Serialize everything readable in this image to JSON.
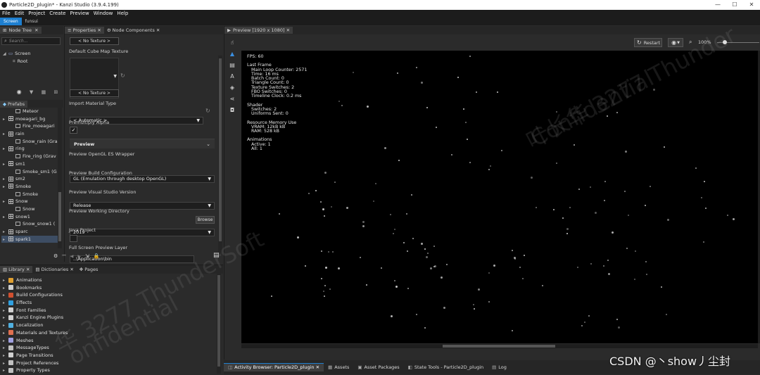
{
  "window": {
    "title": "Particle2D_plugin* - Kanzi Studio (3.9.4.199)",
    "controls": [
      "—",
      "☐",
      "✕"
    ]
  },
  "menu": [
    "File",
    "Edit",
    "Project",
    "Create",
    "Preview",
    "Window",
    "Help"
  ],
  "screen_tabs": [
    "Screen",
    "funsui"
  ],
  "node_tree": {
    "tab": "Node Tree",
    "search_placeholder": "Search...",
    "items": [
      {
        "label": "Screen",
        "icon": "monitor-icon",
        "indent": 0,
        "expanded": true
      },
      {
        "label": "Root",
        "icon": "node-icon",
        "indent": 1,
        "expanded": false
      }
    ]
  },
  "prefabs": {
    "tab": "Prefabs",
    "items": [
      {
        "label": "Meteor",
        "indent": 1,
        "kind": "child"
      },
      {
        "label": "moeagari_bg",
        "indent": 0,
        "kind": "prefab"
      },
      {
        "label": "Fire_moeagari",
        "indent": 1,
        "kind": "child"
      },
      {
        "label": "rain",
        "indent": 0,
        "kind": "prefab"
      },
      {
        "label": "Snow_rain (Gra",
        "indent": 1,
        "kind": "child"
      },
      {
        "label": "ring",
        "indent": 0,
        "kind": "prefab"
      },
      {
        "label": "Fire_ring (Grav",
        "indent": 1,
        "kind": "child"
      },
      {
        "label": "sm1",
        "indent": 0,
        "kind": "prefab"
      },
      {
        "label": "Smoke_sm1 (G",
        "indent": 1,
        "kind": "child"
      },
      {
        "label": "sm2",
        "indent": 0,
        "kind": "prefab"
      },
      {
        "label": "Smoke",
        "indent": 0,
        "kind": "prefab"
      },
      {
        "label": "Smoke",
        "indent": 1,
        "kind": "child"
      },
      {
        "label": "Snow",
        "indent": 0,
        "kind": "prefab"
      },
      {
        "label": "Snow",
        "indent": 1,
        "kind": "child"
      },
      {
        "label": "snow1",
        "indent": 0,
        "kind": "prefab"
      },
      {
        "label": "Snow_snow1 (",
        "indent": 1,
        "kind": "child"
      },
      {
        "label": "sparc",
        "indent": 0,
        "kind": "prefab"
      },
      {
        "label": "spark1",
        "indent": 0,
        "kind": "prefab",
        "selected": true
      }
    ]
  },
  "properties": {
    "tabs": [
      "Properties",
      "Node Components"
    ],
    "no_texture_top": "< No Texture >",
    "default_cube_map_label": "Default Cube Map Texture",
    "no_texture_bottom": "< No Texture >",
    "import_material_type_label": "Import Material Type",
    "import_material_type_value": "< Automatic >",
    "premultiply_alpha_label": "Premultiply Alpha",
    "premultiply_checked": "✓",
    "preview_section": "Preview",
    "opengl_wrapper_label": "Preview OpenGL ES Wrapper",
    "opengl_wrapper_value": "GL (Emulation through desktop OpenGL)",
    "build_config_label": "Preview Build Configuration",
    "build_config_value": "Release",
    "vs_version_label": "Preview Visual Studio Version",
    "vs_version_value": "2019",
    "working_dir_label": "Preview Working Directory",
    "working_dir_value": "..\\Application\\bin",
    "browse_label": "Browse",
    "java_project_label": "Java Project",
    "full_screen_label": "Full Screen Preview Layer"
  },
  "library": {
    "tabs": [
      "Library",
      "Dictionaries",
      "Pages"
    ],
    "items": [
      {
        "label": "Animations",
        "color": "#e0a030"
      },
      {
        "label": "Bookmarks",
        "color": "#d0d0d0"
      },
      {
        "label": "Build Configurations",
        "color": "#d05030"
      },
      {
        "label": "Effects",
        "color": "#30a0e0"
      },
      {
        "label": "Font Families",
        "color": "#d0d0d0"
      },
      {
        "label": "Kanzi Engine Plugins",
        "color": "#d0d0d0"
      },
      {
        "label": "Localization",
        "color": "#50b0e0"
      },
      {
        "label": "Materials and Textures",
        "color": "#e07050"
      },
      {
        "label": "Meshes",
        "color": "#a0a0e0"
      },
      {
        "label": "MessageTypes",
        "color": "#c0c0c0"
      },
      {
        "label": "Page Transitions",
        "color": "#d0d0d0"
      },
      {
        "label": "Project References",
        "color": "#c0c0c0"
      },
      {
        "label": "Property Types",
        "color": "#c0c0c0"
      }
    ]
  },
  "preview": {
    "tab": "Preview [1920 x 1080]",
    "restart_label": "Restart",
    "zoom": "100%",
    "stats": {
      "fps": "FPS: 60",
      "last_frame": "Last Frame",
      "main_loop": "Main Loop Counter: 2571",
      "time": "Time: 16 ms",
      "batch": "Batch Count: 0",
      "triangle": "Triangle Count: 0",
      "texture_switches": "Texture Switches: 2",
      "fbo_switches": "FBO Switches: 0",
      "timeline": "Timeline Clock: 0.2 ms",
      "shader": "Shader",
      "shader_switches": "Switches: 2",
      "uniforms": "Uniforms Sent: 0",
      "resource": "Resource Memory Use",
      "vram": "VRAM: 12kB kB",
      "ram": "RAM: 528 kB",
      "animations": "Animations",
      "active": "Active: 1",
      "all": "All: 1"
    }
  },
  "bottom_tabs": [
    "Activity Browser: Particle2D_plugin",
    "Assets",
    "Asset Packages",
    "State Tools - Particle2D_plugin",
    "Log"
  ],
  "overlay": {
    "csdn": "CSDN @丶show丿尘封",
    "wm1": "叶长华 3277 Thunder",
    "wm2": "Confidential",
    "wm3": "华 3277 ThunderSoft",
    "wm4": "onfidential"
  },
  "colors": {
    "accent": "#1e7fd0",
    "panel": "#2b2b2b",
    "preview_bg": "#000000"
  }
}
